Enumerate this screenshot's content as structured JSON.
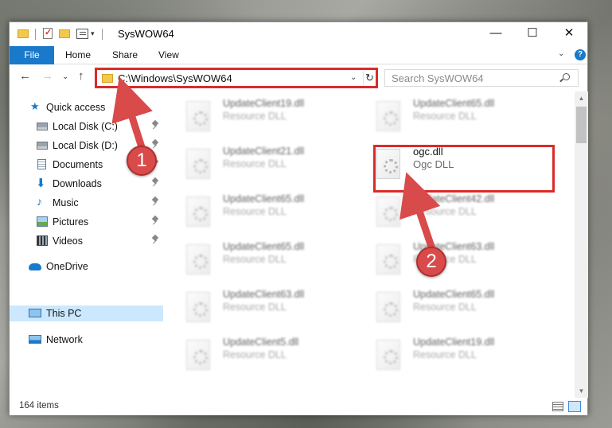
{
  "window": {
    "title": "SysWOW64",
    "qa_arrow": "▾",
    "controls": {
      "minimize": "—",
      "maximize": "☐",
      "close": "✕"
    }
  },
  "ribbon": {
    "tabs": [
      "File",
      "Home",
      "Share",
      "View"
    ],
    "chevron": "⌄",
    "help": "?"
  },
  "nav": {
    "back": "←",
    "forward": "→",
    "recent": "⌄",
    "up": "↑",
    "address": "C:\\Windows\\SysWOW64",
    "address_dropdown": "⌄",
    "refresh": "↻",
    "search_placeholder": "Search SysWOW64"
  },
  "sidebar": {
    "items": [
      {
        "label": "Quick access",
        "icon": "star-icon",
        "pinned": false
      },
      {
        "label": "Local Disk (C:)",
        "icon": "drive-icon",
        "pinned": true
      },
      {
        "label": "Local Disk (D:)",
        "icon": "drive-icon",
        "pinned": true
      },
      {
        "label": "Documents",
        "icon": "documents-icon",
        "pinned": true
      },
      {
        "label": "Downloads",
        "icon": "download-icon",
        "pinned": true
      },
      {
        "label": "Music",
        "icon": "music-icon",
        "pinned": true
      },
      {
        "label": "Pictures",
        "icon": "pictures-icon",
        "pinned": true
      },
      {
        "label": "Videos",
        "icon": "videos-icon",
        "pinned": true
      },
      {
        "label": "OneDrive",
        "icon": "cloud-icon",
        "pinned": false
      },
      {
        "label": "This PC",
        "icon": "computer-icon",
        "pinned": false,
        "selected": true
      },
      {
        "label": "Network",
        "icon": "network-icon",
        "pinned": false
      }
    ]
  },
  "files": {
    "left": [
      {
        "name": "UpdateClient19.dll",
        "type": "Resource DLL"
      },
      {
        "name": "UpdateClient21.dll",
        "type": "Resource DLL"
      },
      {
        "name": "UpdateClient65.dll",
        "type": "Resource DLL"
      },
      {
        "name": "UpdateClient65.dll",
        "type": "Resource DLL"
      },
      {
        "name": "UpdateClient63.dll",
        "type": "Resource DLL"
      },
      {
        "name": "UpdateClient5.dll",
        "type": "Resource DLL"
      }
    ],
    "right": [
      {
        "name": "UpdateClient65.dll",
        "type": "Resource DLL"
      },
      {
        "name": "ogc.dll",
        "type": "Ogc DLL",
        "highlighted": true
      },
      {
        "name": "UpdateClient42.dll",
        "type": "Resource DLL"
      },
      {
        "name": "UpdateClient63.dll",
        "type": "Resource DLL"
      },
      {
        "name": "UpdateClient65.dll",
        "type": "Resource DLL"
      },
      {
        "name": "UpdateClient19.dll",
        "type": "Resource DLL"
      }
    ]
  },
  "status": {
    "item_count": "164 items"
  },
  "callouts": {
    "step1": "1",
    "step2": "2"
  },
  "colors": {
    "accent": "#1979ca",
    "highlight": "#d92b2b",
    "callout": "#d94a4a",
    "selected": "#cce8ff"
  }
}
